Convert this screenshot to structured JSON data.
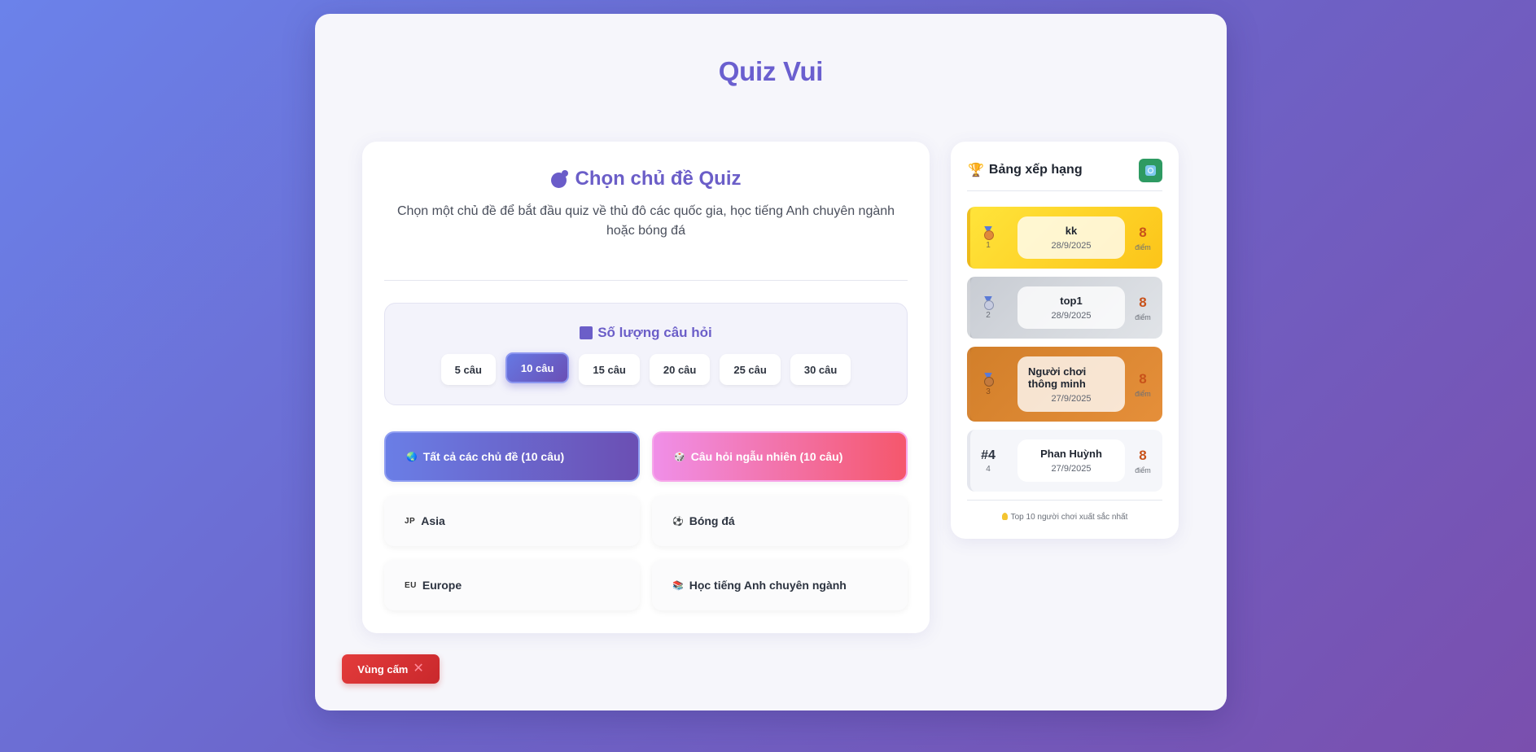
{
  "app": {
    "title": "Quiz Vui"
  },
  "main": {
    "heading": "Chọn chủ đề Quiz",
    "subtitle": "Chọn một chủ đề để bắt đầu quiz về thủ đô các quốc gia, học tiếng Anh chuyên ngành hoặc bóng đá",
    "question_count": {
      "title": "Số lượng câu hỏi",
      "options": [
        "5 câu",
        "10 câu",
        "15 câu",
        "20 câu",
        "25 câu",
        "30 câu"
      ],
      "selected": "10 câu"
    },
    "topics": [
      {
        "icon": "globe-icon",
        "label": "Tất cả các chủ đề (10 câu)"
      },
      {
        "icon": "dice-icon",
        "label": "Câu hỏi ngẫu nhiên (10 câu)"
      },
      {
        "icon": "flag-jp-icon",
        "icon_text": "JP",
        "label": "Asia"
      },
      {
        "icon": "soccer-ball-icon",
        "label": "Bóng đá"
      },
      {
        "icon": "flag-eu-icon",
        "icon_text": "EU",
        "label": "Europe"
      },
      {
        "icon": "books-icon",
        "label": "Học tiếng Anh chuyên ngành"
      }
    ]
  },
  "leaderboard": {
    "title": "Bảng xếp hạng",
    "entries": [
      {
        "rank": "1",
        "name": "kk",
        "date": "28/9/2025",
        "score": "8",
        "unit": "điểm"
      },
      {
        "rank": "2",
        "name": "top1",
        "date": "28/9/2025",
        "score": "8",
        "unit": "điểm"
      },
      {
        "rank": "3",
        "name": "Người chơi thông minh",
        "date": "27/9/2025",
        "score": "8",
        "unit": "điểm"
      },
      {
        "rank": "4",
        "rank_label": "#4",
        "name": "Phan Huỳnh",
        "date": "27/9/2025",
        "score": "8",
        "unit": "điểm"
      }
    ],
    "footer": "Top 10 người chơi xuất sắc nhất"
  },
  "ban_button": {
    "label": "Vùng cấm"
  },
  "colors": {
    "accent": "#6b5ec8",
    "gold": "#fcc419",
    "silver": "#c8ccd3",
    "bronze": "#d27f2a",
    "danger": "#e33b3b",
    "refresh": "#2e9a62"
  }
}
